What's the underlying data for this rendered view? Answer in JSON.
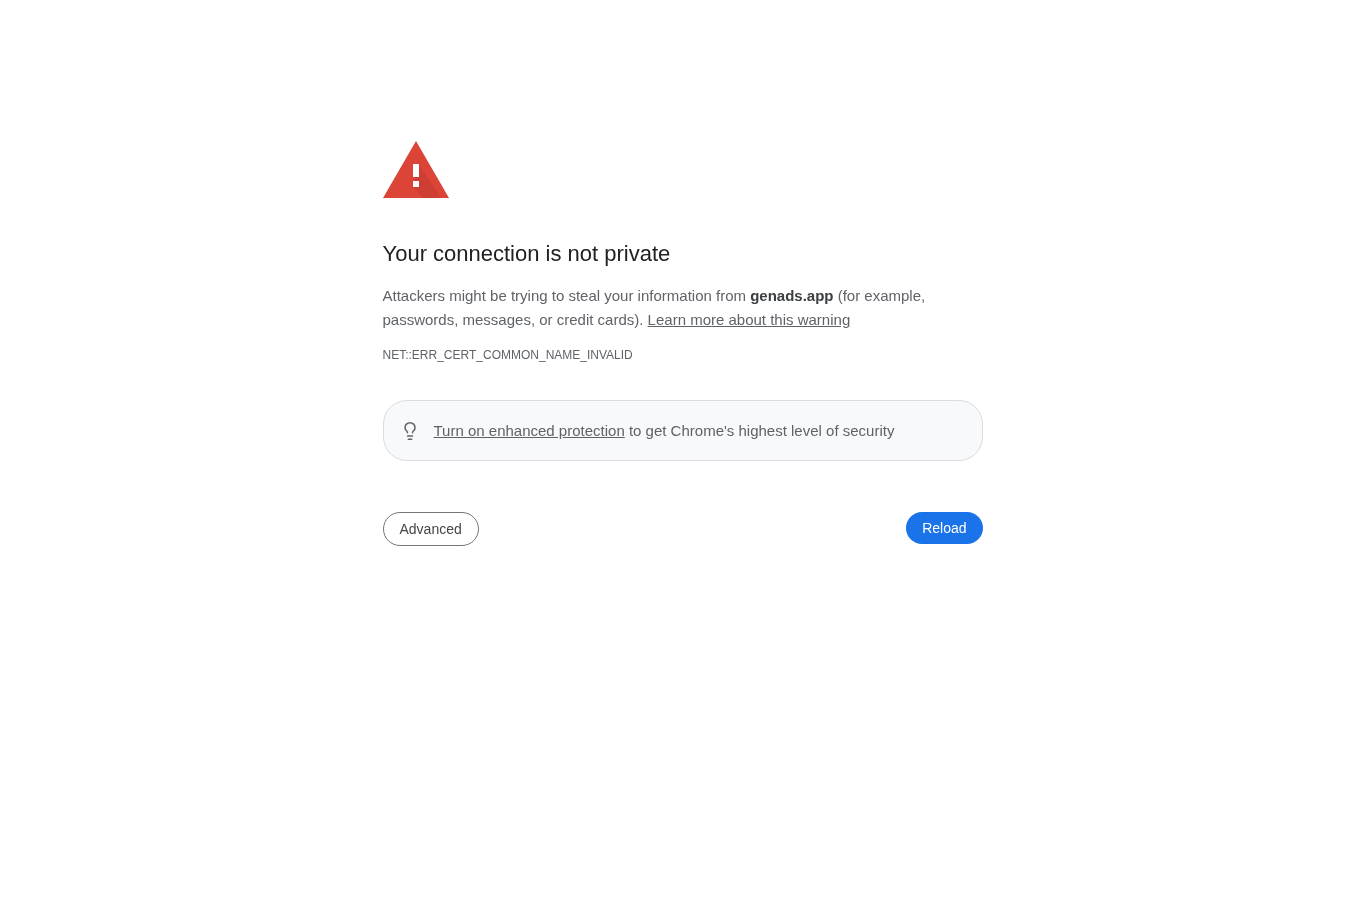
{
  "warning": {
    "title": "Your connection is not private",
    "message": "Attackers might be trying to steal your information from **genads.app** (for example, passwords, messages, or credit cards).",
    "link": "Learn more about this warning",
    "error_code": "NET::ERR_CERT_COMMON_NAME_INVALID"
  },
  "tip": {
    "link": "Turn on enhanced protection",
    "text": "to get Chrome's highest level of security"
  },
  "buttons": [
    {
      "label": "Advanced",
      "kind": "secondary"
    },
    {
      "label": "Reload",
      "kind": "primary"
    }
  ]
}
